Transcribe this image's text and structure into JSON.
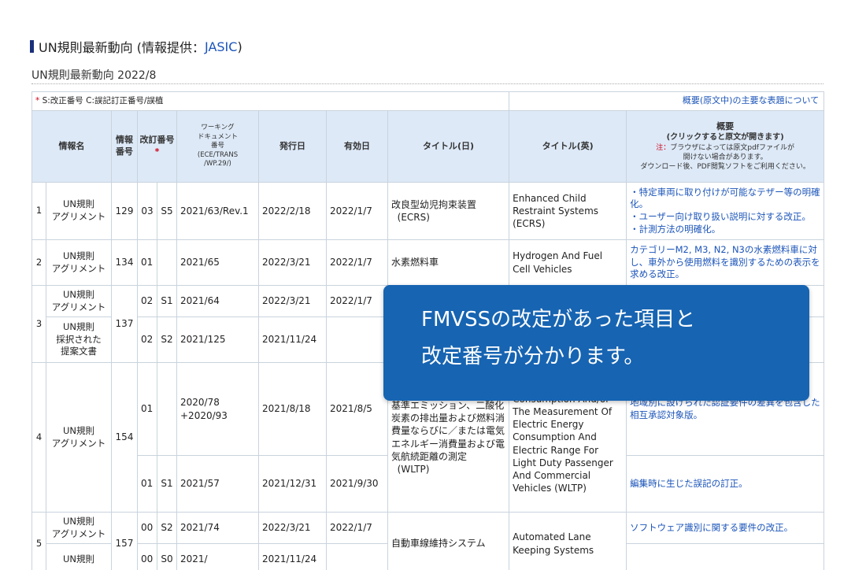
{
  "header": {
    "title_prefix": "UN規則最新動向 (情報提供：",
    "title_link": "JASIC",
    "title_suffix": ")",
    "subtitle": "UN規則最新動向 2022/8"
  },
  "legend": {
    "asterisk": "*",
    "text": " S:改正番号 C:誤記訂正番号/誤植",
    "summary_link": "概要(原文中)の主要な表題について"
  },
  "columns": {
    "name": "情報名",
    "number": "情報番号",
    "revision": "改訂番号",
    "revision_asterisk": "*",
    "wd_line1": "ワーキング",
    "wd_line2": "ドキュメント",
    "wd_line3": "番号",
    "wd_line4": "(ECE/TRANS",
    "wd_line5": "/WP.29/)",
    "issue_date": "発行日",
    "effective_date": "有効日",
    "title_jp": "タイトル(日)",
    "title_en": "タイトル(英)",
    "summary_title": "概要",
    "summary_sub": "(クリックすると原文が開きます)",
    "summary_note_red": "注：",
    "summary_note": "ブラウザによっては原文pdfファイルが",
    "summary_note2": "開けない場合があります。",
    "summary_note3": "ダウンロード後、PDF閲覧ソフトをご利用ください。"
  },
  "rows": {
    "r1": {
      "index": "1",
      "name1": "UN規則",
      "name2": "アグリメント",
      "number": "129",
      "rev": "03",
      "s": "S5",
      "wd": "2021/63/Rev.1",
      "issue": "2022/2/18",
      "effective": "2022/1/7",
      "title_jp1": "改良型幼児拘束装置",
      "title_jp2": "(ECRS)",
      "title_en": "Enhanced Child Restraint Systems (ECRS)",
      "summary1": "・特定車両に取り付けが可能なテザー等の明確化。",
      "summary2": "・ユーザー向け取り扱い説明に対する改正。",
      "summary3": "・計測方法の明確化。"
    },
    "r2": {
      "index": "2",
      "name1": "UN規則",
      "name2": "アグリメント",
      "number": "134",
      "rev": "01",
      "s": "",
      "wd": "2021/65",
      "issue": "2022/3/21",
      "effective": "2022/1/7",
      "title_jp": "水素燃料車",
      "title_en": "Hydrogen And Fuel Cell Vehicles",
      "summary": "カテゴリーM2, M3, N2, N3の水素燃料車に対し、車外から使用燃料を識別するための表示を求める改正。"
    },
    "r3a": {
      "index": "3",
      "name1": "UN規則",
      "name2": "アグリメント",
      "number": "137",
      "rev": "02",
      "s": "S1",
      "wd": "2021/64",
      "issue": "2022/3/21",
      "effective": "2022/1/7"
    },
    "r3b": {
      "name1": "UN規則",
      "name2": "採択された",
      "name3": "提案文書",
      "rev": "02",
      "s": "S2",
      "wd": "2021/125",
      "issue": "2021/11/24",
      "effective": ""
    },
    "r4a": {
      "index": "4",
      "name1": "UN規則",
      "name2": "アグリメント",
      "number": "154",
      "rev": "01",
      "s": "",
      "wd1": "2020/78",
      "wd2": "+2020/93",
      "issue": "2021/8/18",
      "effective": "2021/8/5",
      "title_jp": "基準エミッション、二酸化炭素の排出量および燃料消費量ならびに／または電気エネルギー消費量および電気航続距離の測定",
      "title_jp2": "(WLTP)",
      "title_en": "Dioxide And Fuel Consumption And/or The Measurement Of Electric Energy Consumption And Electric Range For Light Duty Passenger And Commercial Vehicles (WLTP)",
      "summary": "地域別に設けられた認証要件の差異を包含した相互承認対象版。"
    },
    "r4b": {
      "rev": "01",
      "s": "S1",
      "wd": "2021/57",
      "issue": "2021/12/31",
      "effective": "2021/9/30",
      "summary": "編集時に生じた誤記の訂正。"
    },
    "r5a": {
      "index": "5",
      "name1": "UN規則",
      "name2": "アグリメント",
      "number": "157",
      "rev": "00",
      "s": "S2",
      "wd": "2021/74",
      "issue": "2022/3/21",
      "effective": "2022/1/7",
      "title_jp": "自動車線維持システム",
      "title_en": "Automated Lane Keeping Systems",
      "summary": "ソフトウェア識別に関する要件の改正。"
    },
    "r5b": {
      "name1": "UN規則",
      "rev": "00",
      "s": "S0",
      "wd": "2021/",
      "issue": "2021/11/24"
    }
  },
  "tooltip": {
    "line1": "FMVSSの改定があった項目と",
    "line2": "改定番号が分かります。"
  }
}
